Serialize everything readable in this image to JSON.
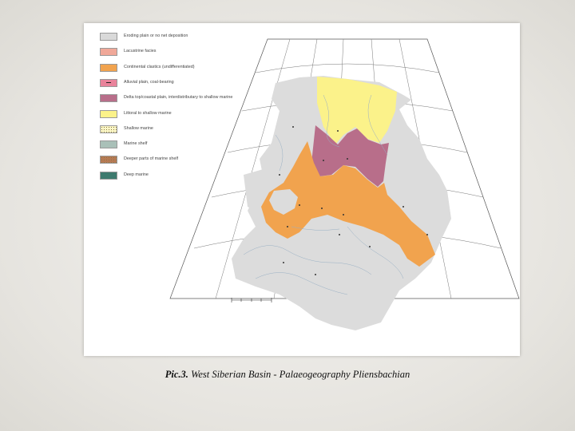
{
  "figure": {
    "legend": [
      {
        "label": "Eroding plain or no net deposition",
        "color": "#d9d9d9",
        "pattern": "solid"
      },
      {
        "label": "Lacustrine facies",
        "color": "#f0a899",
        "pattern": "solid"
      },
      {
        "label": "Continental clastics (undifferentiated)",
        "color": "#f1a34e",
        "pattern": "solid"
      },
      {
        "label": "Alluvial plain, coal-bearing",
        "color": "#e9839b",
        "pattern": "dash"
      },
      {
        "label": "Delta top/coastal plain, interdistributary to shallow marine",
        "color": "#b86e8a",
        "pattern": "solid"
      },
      {
        "label": "Littoral to shallow marine",
        "color": "#fbf28a",
        "pattern": "solid"
      },
      {
        "label": "Shallow marine",
        "color": "#fbf6c6",
        "pattern": "dots"
      },
      {
        "label": "Marine shelf",
        "color": "#a9c0b8",
        "pattern": "solid"
      },
      {
        "label": "Deeper parts of marine shelf",
        "color": "#b77a55",
        "pattern": "dots"
      },
      {
        "label": "Deep marine",
        "color": "#3d7a6e",
        "pattern": "solid"
      }
    ],
    "map_region_label": "Khanty\nMansiysk"
  },
  "caption": {
    "prefix": "Pic.3.",
    "text": " West Siberian Basin - Palaeogeography Pliensbachian"
  }
}
